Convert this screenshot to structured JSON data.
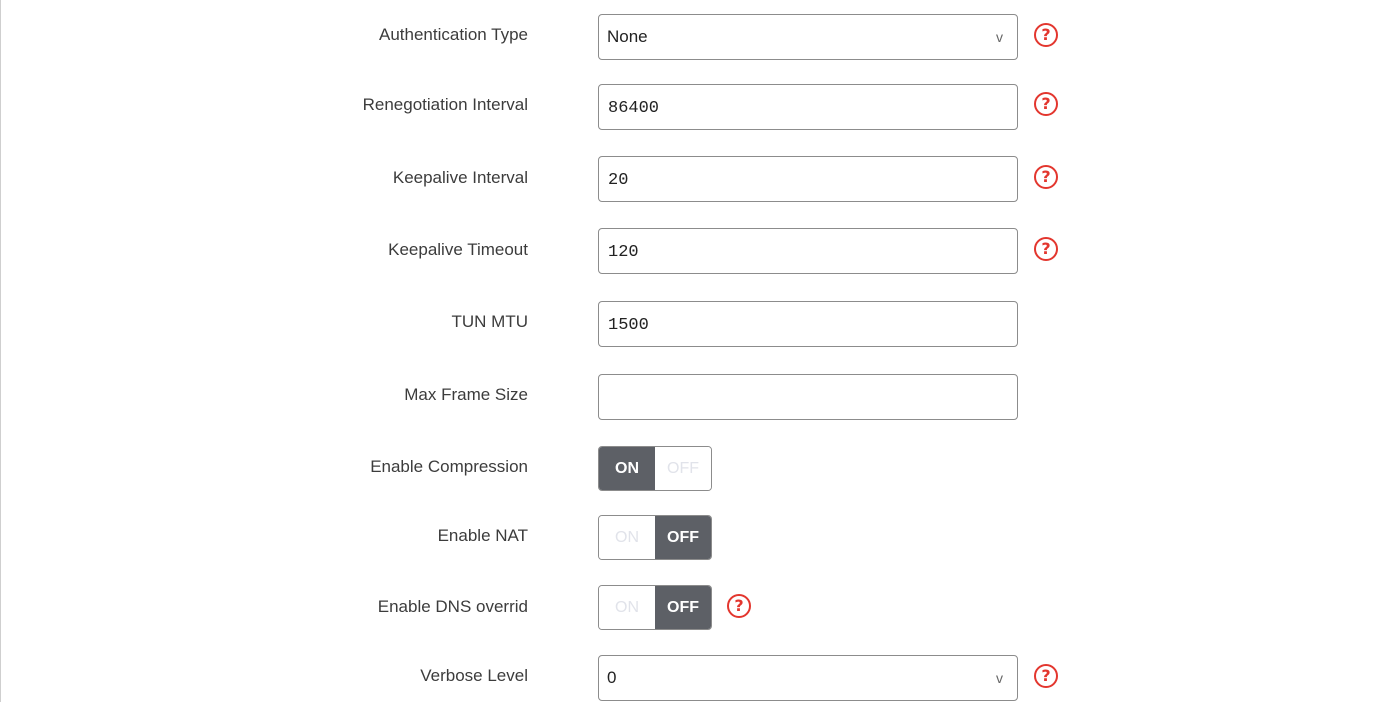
{
  "fields": {
    "auth_type": {
      "label": "Authentication Type",
      "value": "None",
      "chevron": "v"
    },
    "renegotiation": {
      "label": "Renegotiation Interval",
      "value": "86400"
    },
    "keepalive_interval": {
      "label": "Keepalive Interval",
      "value": "20"
    },
    "keepalive_timeout": {
      "label": "Keepalive Timeout",
      "value": "120"
    },
    "tun_mtu": {
      "label": "TUN MTU",
      "value": "1500"
    },
    "max_frame": {
      "label": "Max Frame Size",
      "value": ""
    },
    "compression": {
      "label": "Enable Compression",
      "on": "ON",
      "off": "OFF",
      "state": "on"
    },
    "nat": {
      "label": "Enable NAT",
      "on": "ON",
      "off": "OFF",
      "state": "off"
    },
    "dns": {
      "label": "Enable DNS overrid",
      "on": "ON",
      "off": "OFF",
      "state": "off"
    },
    "verbose": {
      "label": "Verbose Level",
      "value": "0",
      "chevron": "v"
    }
  },
  "help_glyph": "?",
  "icons": {
    "help": "question-circle-icon",
    "chevron": "chevron-down-icon"
  },
  "colors": {
    "help": "#e3362e",
    "toggle_active": "#5d6066",
    "border": "#8c8c8c"
  }
}
